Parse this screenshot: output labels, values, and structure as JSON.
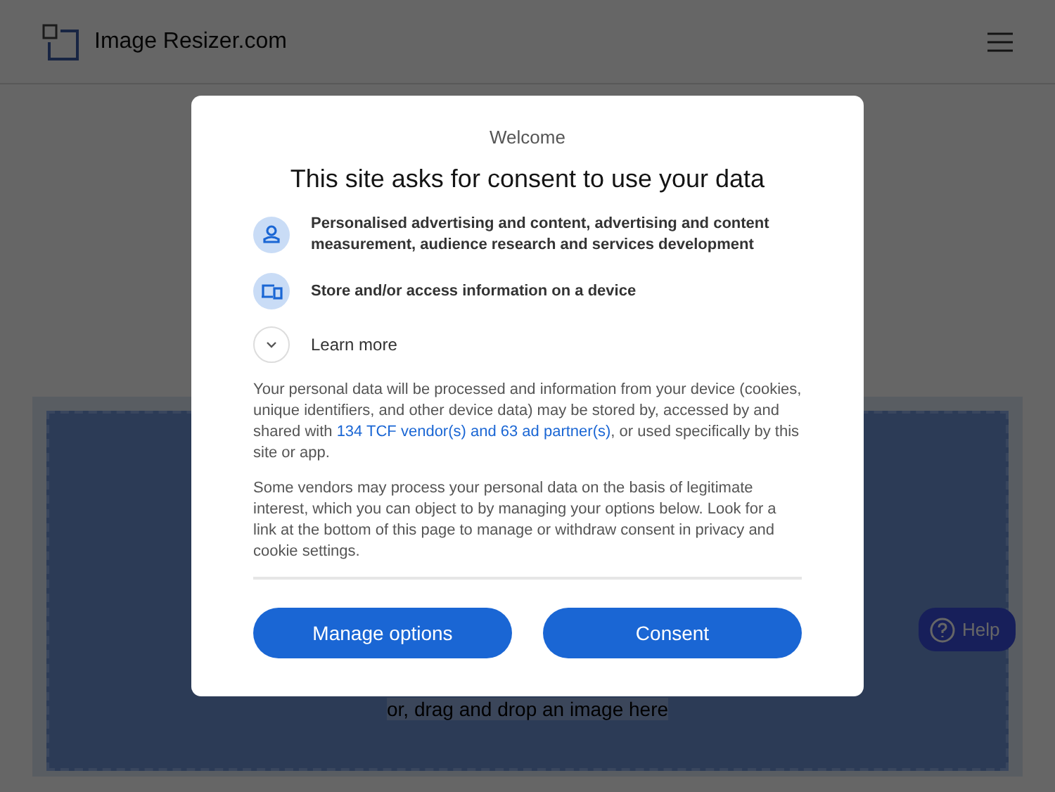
{
  "header": {
    "logo_text": "Image Resizer.com"
  },
  "dropzone": {
    "text": "or, drag and drop an image here"
  },
  "help_button": {
    "label": "Help"
  },
  "dialog": {
    "subtitle": "Welcome",
    "title": "This site asks for consent to use your data",
    "purposes": [
      {
        "kind": "person",
        "text": "Personalised advertising and content, advertising and content measurement, audience research and services development"
      },
      {
        "kind": "device",
        "text": "Store and/or access information on a device"
      }
    ],
    "learn_more": {
      "label": "Learn more",
      "expanded": false
    },
    "paragraph_1": {
      "before": "Your personal data will be processed and information from your device (cookies, unique identifiers, and other device data) may be stored by, accessed by and shared with ",
      "link": "134 TCF vendor(s) and 63 ad partner(s)",
      "after": ", or used specifically by this site or app."
    },
    "paragraph_2": "Some vendors may process your personal data on the basis of legitimate interest, which you can object to by managing your options below. Look for a link at the bottom of this page to manage or withdraw consent in privacy and cookie settings.",
    "buttons": [
      "Manage options",
      "Consent"
    ]
  }
}
